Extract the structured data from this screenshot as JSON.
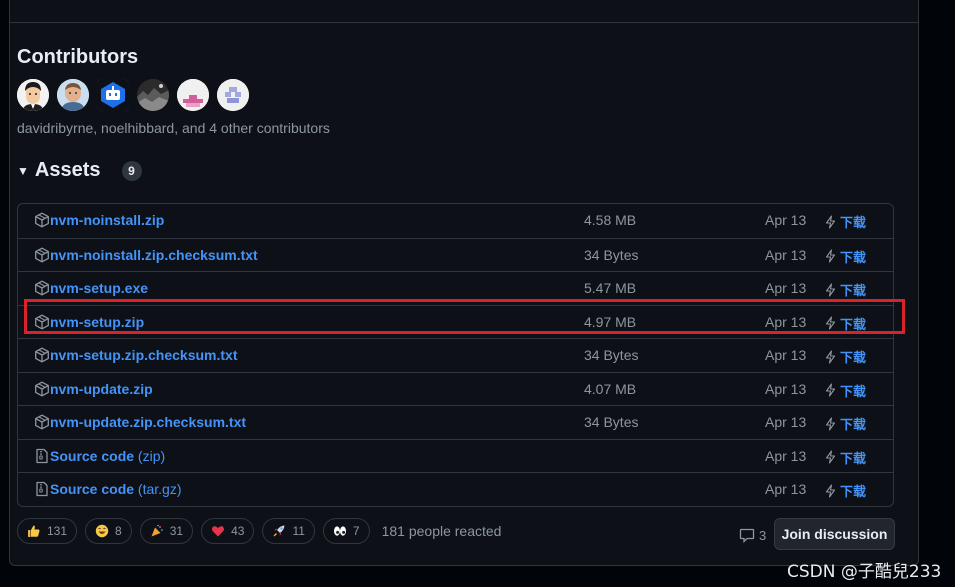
{
  "contributors": {
    "title": "Contributors",
    "summary": "davidribyrne, noelhibbard, and 4 other contributors",
    "avatars": [
      "avatar-cartoon-man",
      "avatar-man-photo",
      "avatar-blue-robot",
      "avatar-landscape-photo",
      "avatar-pink-identicon",
      "avatar-purple-identicon"
    ]
  },
  "assets": {
    "title": "Assets",
    "count": "9",
    "download_label": "下载",
    "items": [
      {
        "name": "nvm-noinstall.zip",
        "suffix": "",
        "size": "4.58 MB",
        "date": "Apr 13",
        "icon": "package-icon"
      },
      {
        "name": "nvm-noinstall.zip.checksum.txt",
        "suffix": "",
        "size": "34 Bytes",
        "date": "Apr 13",
        "icon": "package-icon"
      },
      {
        "name": "nvm-setup.exe",
        "suffix": "",
        "size": "5.47 MB",
        "date": "Apr 13",
        "icon": "package-icon"
      },
      {
        "name": "nvm-setup.zip",
        "suffix": "",
        "size": "4.97 MB",
        "date": "Apr 13",
        "icon": "package-icon",
        "highlighted": true
      },
      {
        "name": "nvm-setup.zip.checksum.txt",
        "suffix": "",
        "size": "34 Bytes",
        "date": "Apr 13",
        "icon": "package-icon"
      },
      {
        "name": "nvm-update.zip",
        "suffix": "",
        "size": "4.07 MB",
        "date": "Apr 13",
        "icon": "package-icon"
      },
      {
        "name": "nvm-update.zip.checksum.txt",
        "suffix": "",
        "size": "34 Bytes",
        "date": "Apr 13",
        "icon": "package-icon"
      },
      {
        "name": "Source code",
        "suffix": " (zip)",
        "size": "",
        "date": "Apr 13",
        "icon": "file-zip-icon"
      },
      {
        "name": "Source code",
        "suffix": " (tar.gz)",
        "size": "",
        "date": "Apr 13",
        "icon": "file-zip-icon"
      }
    ]
  },
  "reactions": {
    "items": [
      {
        "emoji": "thumbs-up-icon",
        "count": "131"
      },
      {
        "emoji": "laugh-icon",
        "count": "8"
      },
      {
        "emoji": "hooray-icon",
        "count": "31"
      },
      {
        "emoji": "heart-icon",
        "count": "43"
      },
      {
        "emoji": "rocket-icon",
        "count": "11"
      },
      {
        "emoji": "eyes-icon",
        "count": "7"
      }
    ],
    "summary": "181 people reacted"
  },
  "discussion": {
    "comment_count": "3",
    "join_label": "Join discussion"
  },
  "watermark": "CSDN @子酷兒233",
  "colors": {
    "link": "#4493f8",
    "highlight_border": "#d9222a",
    "background": "#0d1117",
    "border": "#30363d"
  }
}
